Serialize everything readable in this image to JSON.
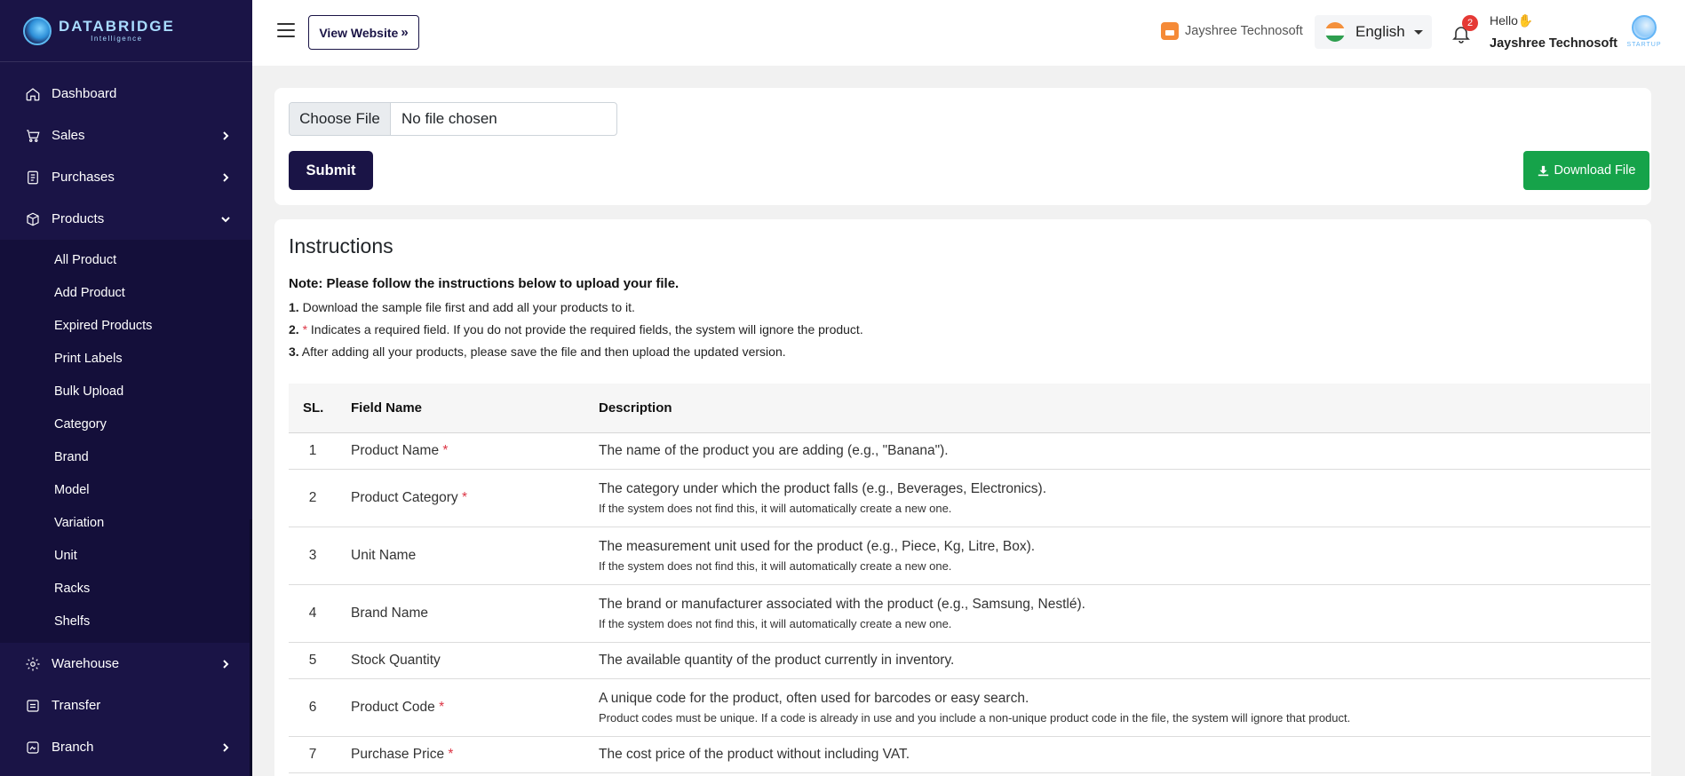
{
  "brand": {
    "name": "DATABRIDGE",
    "tagline": "Intelligence"
  },
  "sidebar": {
    "items": [
      {
        "label": "Dashboard",
        "icon": "home-icon"
      },
      {
        "label": "Sales",
        "icon": "cart-icon"
      },
      {
        "label": "Purchases",
        "icon": "receipt-icon"
      },
      {
        "label": "Products",
        "icon": "box-icon"
      },
      {
        "label": "Warehouse",
        "icon": "gear-icon"
      },
      {
        "label": "Transfer",
        "icon": "transfer-icon"
      },
      {
        "label": "Branch",
        "icon": "branch-icon"
      }
    ],
    "products_submenu": [
      "All Product",
      "Add Product",
      "Expired Products",
      "Print Labels",
      "Bulk Upload",
      "Category",
      "Brand",
      "Model",
      "Variation",
      "Unit",
      "Racks",
      "Shelfs"
    ]
  },
  "header": {
    "view_website": "View Website",
    "shop_name": "Jayshree Technosoft",
    "language": "English",
    "notification_count": "2",
    "greeting": "Hello✋",
    "user_name": "Jayshree Technosoft",
    "avatar_text": "STARTUP"
  },
  "upload": {
    "choose_file": "Choose File",
    "no_file": "No file chosen",
    "submit": "Submit",
    "download": "Download File"
  },
  "instructions": {
    "title": "Instructions",
    "note_label": "Note:",
    "note_text": " Please follow the instructions below to upload your file.",
    "steps": [
      {
        "num": "1.",
        "text": " Download the sample file first and add all your products to it."
      },
      {
        "num": "2.",
        "star": " *",
        "text": " Indicates a required field. If you do not provide the required fields, the system will ignore the product."
      },
      {
        "num": "3.",
        "text": " After adding all your products, please save the file and then upload the updated version."
      }
    ],
    "columns": [
      "SL.",
      "Field Name",
      "Description"
    ],
    "rows": [
      {
        "sl": "1",
        "field": "Product Name",
        "required": true,
        "desc": "The name of the product you are adding (e.g., \"Banana\").",
        "sub": ""
      },
      {
        "sl": "2",
        "field": "Product Category",
        "required": true,
        "desc": "The category under which the product falls (e.g., Beverages, Electronics).",
        "sub": "If the system does not find this, it will automatically create a new one."
      },
      {
        "sl": "3",
        "field": "Unit Name",
        "required": false,
        "desc": "The measurement unit used for the product (e.g., Piece, Kg, Litre, Box).",
        "sub": "If the system does not find this, it will automatically create a new one."
      },
      {
        "sl": "4",
        "field": "Brand Name",
        "required": false,
        "desc": "The brand or manufacturer associated with the product (e.g., Samsung, Nestlé).",
        "sub": "If the system does not find this, it will automatically create a new one."
      },
      {
        "sl": "5",
        "field": "Stock Quantity",
        "required": false,
        "desc": "The available quantity of the product currently in inventory.",
        "sub": ""
      },
      {
        "sl": "6",
        "field": "Product Code",
        "required": true,
        "desc": "A unique code for the product, often used for barcodes or easy search.",
        "sub": "Product codes must be unique. If a code is already in use and you include a non-unique product code in the file, the system will ignore that product."
      },
      {
        "sl": "7",
        "field": "Purchase Price",
        "required": true,
        "desc": "The cost price of the product without including VAT.",
        "sub": ""
      }
    ],
    "required_mark": "*"
  },
  "colors": {
    "sidebar": "#1a1446",
    "accent": "#1a1446",
    "download": "#16a34a",
    "required": "#dc3545",
    "badge": "#e53935"
  }
}
